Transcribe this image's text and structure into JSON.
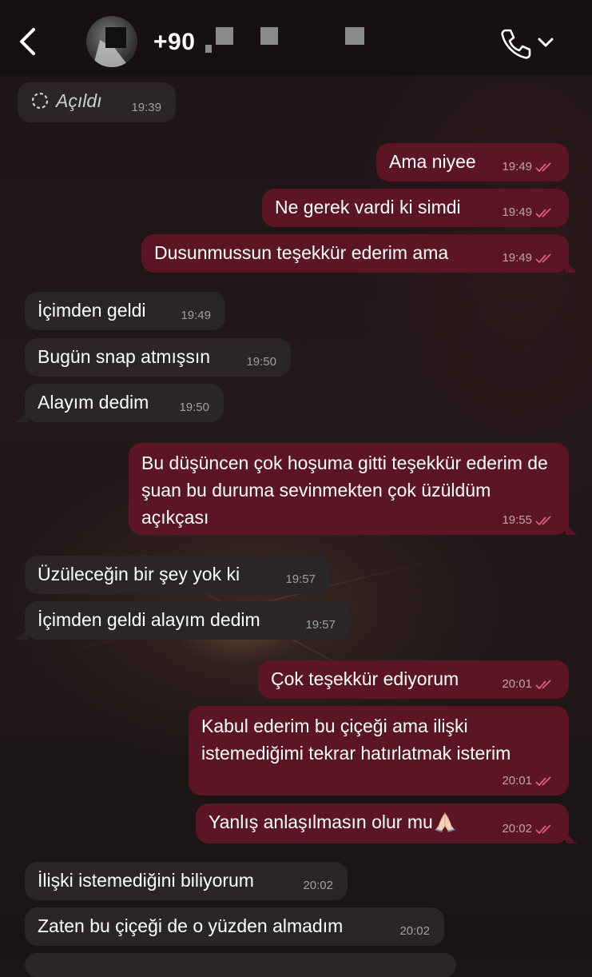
{
  "header": {
    "contact_name": "+90 ",
    "back_icon": "chevron-left-icon",
    "call_icon": "phone-icon",
    "menu_icon": "chevron-down-icon"
  },
  "colors": {
    "incoming_bubble": "#2a2627",
    "outgoing_bubble": "#5b1524",
    "read_tick": "#e0607a"
  },
  "messages": [
    {
      "dir": "in",
      "text": "Açıldı",
      "time": "19:39",
      "type": "opened"
    },
    {
      "dir": "out",
      "text": "Ama niyee",
      "time": "19:49"
    },
    {
      "dir": "out",
      "text": "Ne gerek vardi ki simdi",
      "time": "19:49"
    },
    {
      "dir": "out",
      "text": "Dusunmussun teşekkür ederim ama",
      "time": "19:49"
    },
    {
      "dir": "in",
      "text": "İçimden geldi",
      "time": "19:49"
    },
    {
      "dir": "in",
      "text": "Bugün snap atmışsın",
      "time": "19:50"
    },
    {
      "dir": "in",
      "text": "Alayım dedim",
      "time": "19:50"
    },
    {
      "dir": "out",
      "text": "Bu düşüncen çok hoşuma gitti teşekkür ederim de şuan bu duruma sevinmekten çok üzüldüm açıkçası",
      "time": "19:55"
    },
    {
      "dir": "in",
      "text": "Üzüleceğin bir şey yok ki",
      "time": "19:57"
    },
    {
      "dir": "in",
      "text": "İçimden geldi alayım dedim",
      "time": "19:57"
    },
    {
      "dir": "out",
      "text": "Çok teşekkür ediyorum",
      "time": "20:01"
    },
    {
      "dir": "out",
      "text": "Kabul ederim bu çiçeği ama ilişki istemediğimi tekrar hatırlatmak isterim",
      "time": "20:01"
    },
    {
      "dir": "out",
      "text": "Yanlış anlaşılmasın olur mu",
      "time": "20:02",
      "emoji": "folded-hands-emoji"
    },
    {
      "dir": "in",
      "text": "İlişki istemediğini biliyorum",
      "time": "20:02"
    },
    {
      "dir": "in",
      "text": "Zaten bu çiçeği de o yüzden almadım",
      "time": "20:02"
    }
  ]
}
